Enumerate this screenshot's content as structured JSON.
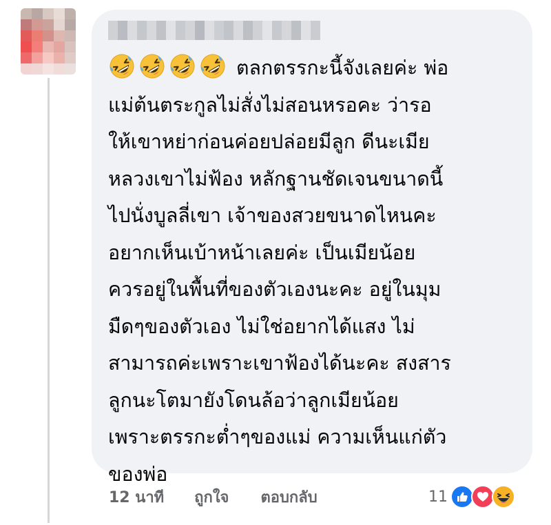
{
  "comment": {
    "author_blurred": true,
    "emoji": [
      "rolling-on-floor-laughing",
      "rolling-on-floor-laughing",
      "rolling-on-floor-laughing",
      "rolling-on-floor-laughing"
    ],
    "lines": [
      "ตลกตรรกะนี้จังเลยค่ะ พ่อ",
      "แม่ต้นตระกูลไม่สั่งไม่สอนหรอคะ ว่ารอ",
      "ให้เขาหย่าก่อนค่อยปล่อยมีลูก ดีนะเมีย",
      "หลวงเขาไม่ฟ้อง หลักฐานชัดเจนขนาดนี้",
      "ไปนั่งบูลลี่เขา เจ้าของสวยขนาดไหนคะ",
      "อยากเห็นเบ้าหน้าเลยค่ะ เป็นเมียน้อย",
      "ควรอยู่ในพื้นที่ของตัวเองนะคะ อยู่ในมุม",
      "มืดๆของตัวเอง ไม่ใช่อยากได้แสง ไม่",
      "สามารถค่ะเพราะเขาฟ้องได้นะคะ สงสาร",
      "ลูกนะโตมายังโดนล้อว่าลูกเมียน้อย",
      "เพราะตรรกะต่ำๆของแม่ ความเห็นแก่ตัว",
      "ของพ่อ"
    ]
  },
  "footer": {
    "time": "12 นาที",
    "like_label": "ถูกใจ",
    "reply_label": "ตอบกลับ"
  },
  "reactions": {
    "count": "11",
    "types": [
      "like",
      "love",
      "haha"
    ]
  },
  "colors": {
    "bubble": "#f0f2f5",
    "text": "#050505",
    "meta": "#65676b",
    "like_blue": "#1877f2",
    "love_red": "#f33e58",
    "haha_yellow": "#f7b125"
  }
}
